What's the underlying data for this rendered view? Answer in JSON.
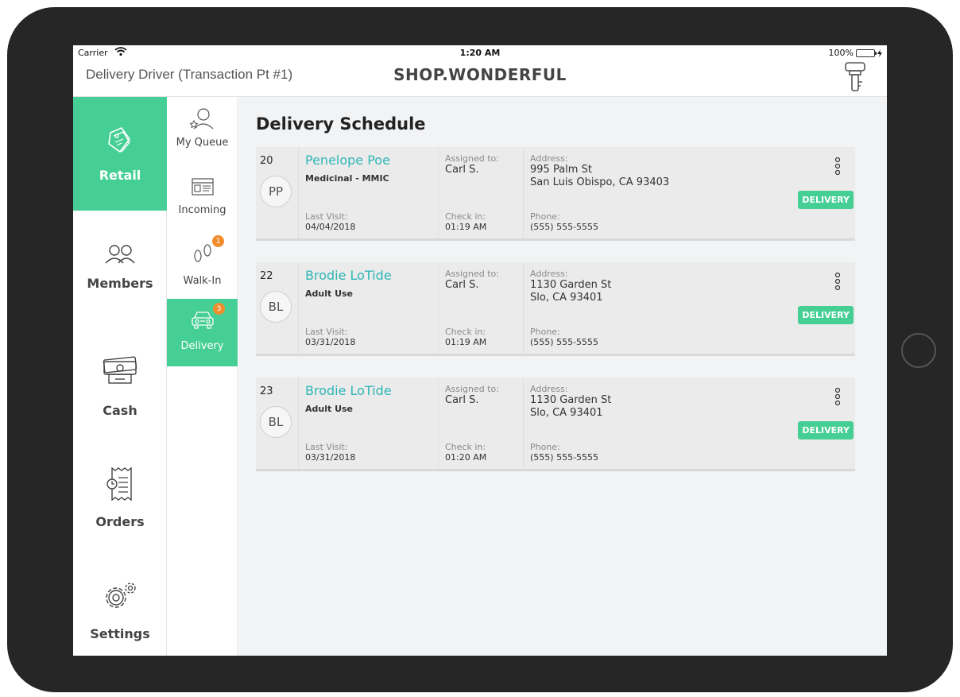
{
  "status_bar": {
    "carrier": "Carrier",
    "time": "1:20 AM",
    "battery": "100%",
    "battery_level": 1.0
  },
  "header": {
    "title": "Delivery  Driver (Transaction Pt #1)",
    "brand": "SHOP.WONDERFUL"
  },
  "nav": {
    "items": [
      {
        "label": "Retail",
        "icon": "tag-icon",
        "active": true
      },
      {
        "label": "Members",
        "icon": "members-icon"
      },
      {
        "label": "Cash",
        "icon": "cash-icon"
      },
      {
        "label": "Orders",
        "icon": "orders-icon"
      },
      {
        "label": "Settings",
        "icon": "gear-icon"
      }
    ]
  },
  "subnav": {
    "items": [
      {
        "label": "My Queue",
        "icon": "queue-icon"
      },
      {
        "label": "Incoming",
        "icon": "incoming-icon"
      },
      {
        "label": "Walk-In",
        "icon": "footprint-icon",
        "badge": "1"
      },
      {
        "label": "Delivery",
        "icon": "car-icon",
        "badge": "3",
        "active": true
      }
    ]
  },
  "content": {
    "title": "Delivery Schedule",
    "labels": {
      "last_visit": "Last Visit:",
      "assigned": "Assigned to:",
      "check_in": "Check in:",
      "address": "Address:",
      "phone": "Phone:",
      "button": "DELIVERY"
    },
    "orders": [
      {
        "number": "20",
        "initials": "PP",
        "name": "Penelope Poe",
        "type": "Medicinal - MMIC",
        "last_visit": "04/04/2018",
        "assigned": "Carl S.",
        "check_in": "01:19 AM",
        "address1": "995 Palm St",
        "address2": "San Luis Obispo, CA 93403",
        "phone": "(555) 555-5555"
      },
      {
        "number": "22",
        "initials": "BL",
        "name": "Brodie LoTide",
        "type": "Adult Use",
        "last_visit": "03/31/2018",
        "assigned": "Carl S.",
        "check_in": "01:19 AM",
        "address1": "1130 Garden St",
        "address2": "Slo, CA 93401",
        "phone": "(555) 555-5555"
      },
      {
        "number": "23",
        "initials": "BL",
        "name": "Brodie LoTide",
        "type": "Adult Use",
        "last_visit": "03/31/2018",
        "assigned": "Carl S.",
        "check_in": "01:20 AM",
        "address1": "1130 Garden St",
        "address2": "Slo, CA 93401",
        "phone": "(555) 555-5555"
      }
    ]
  }
}
